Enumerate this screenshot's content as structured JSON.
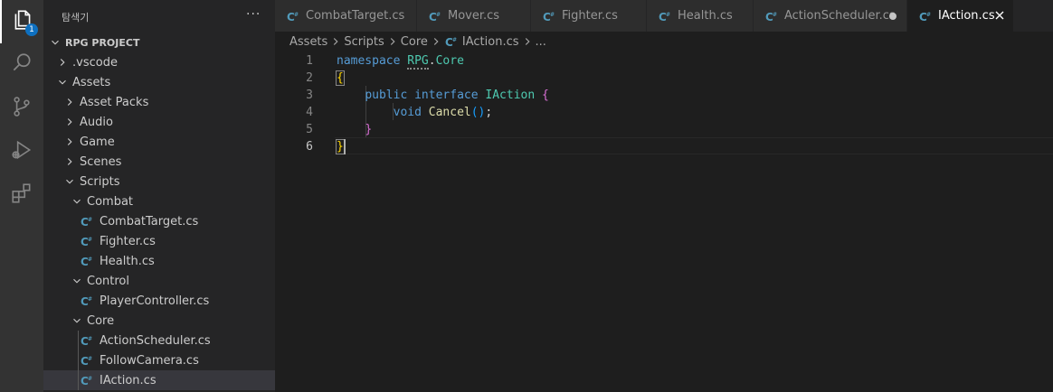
{
  "colors": {
    "activity_bar": "#333333",
    "sidebar": "#252526",
    "editor": "#1e1e1e",
    "badge": "#0e70c0",
    "csharp_icon": "#519aba"
  },
  "activity_bar": {
    "items": [
      {
        "icon": "files-icon",
        "badge": "1"
      },
      {
        "icon": "search-icon"
      },
      {
        "icon": "source-control-icon"
      },
      {
        "icon": "run-debug-icon"
      },
      {
        "icon": "extensions-icon"
      }
    ]
  },
  "sidebar": {
    "title": "탐색기",
    "more": "···",
    "section": "RPG PROJECT",
    "tree": [
      {
        "label": ".vscode",
        "kind": "folder",
        "open": false,
        "depth": 0
      },
      {
        "label": "Assets",
        "kind": "folder",
        "open": true,
        "depth": 0
      },
      {
        "label": "Asset Packs",
        "kind": "folder",
        "open": false,
        "depth": 1
      },
      {
        "label": "Audio",
        "kind": "folder",
        "open": false,
        "depth": 1
      },
      {
        "label": "Game",
        "kind": "folder",
        "open": false,
        "depth": 1
      },
      {
        "label": "Scenes",
        "kind": "folder",
        "open": false,
        "depth": 1
      },
      {
        "label": "Scripts",
        "kind": "folder",
        "open": true,
        "depth": 1
      },
      {
        "label": "Combat",
        "kind": "folder",
        "open": true,
        "depth": 2
      },
      {
        "label": "CombatTarget.cs",
        "kind": "file",
        "depth": 3
      },
      {
        "label": "Fighter.cs",
        "kind": "file",
        "depth": 3
      },
      {
        "label": "Health.cs",
        "kind": "file",
        "depth": 3
      },
      {
        "label": "Control",
        "kind": "folder",
        "open": true,
        "depth": 2
      },
      {
        "label": "PlayerController.cs",
        "kind": "file",
        "depth": 3
      },
      {
        "label": "Core",
        "kind": "folder",
        "open": true,
        "depth": 2
      },
      {
        "label": "ActionScheduler.cs",
        "kind": "file",
        "depth": 3
      },
      {
        "label": "FollowCamera.cs",
        "kind": "file",
        "depth": 3
      },
      {
        "label": "IAction.cs",
        "kind": "file",
        "depth": 3,
        "selected": true
      }
    ]
  },
  "tabs": [
    {
      "label": "CombatTarget.cs",
      "active": false,
      "dirty": false
    },
    {
      "label": "Mover.cs",
      "active": false,
      "dirty": false
    },
    {
      "label": "Fighter.cs",
      "active": false,
      "dirty": false
    },
    {
      "label": "Health.cs",
      "active": false,
      "dirty": false
    },
    {
      "label": "ActionScheduler.cs",
      "active": false,
      "dirty": true
    },
    {
      "label": "IAction.cs",
      "active": true,
      "dirty": false
    }
  ],
  "breadcrumb": {
    "parts": [
      "Assets",
      "Scripts",
      "Core"
    ],
    "file": "IAction.cs",
    "tail": "..."
  },
  "editor": {
    "line_numbers": [
      "1",
      "2",
      "3",
      "4",
      "5",
      "6"
    ],
    "current_line": 6,
    "lines": [
      [
        {
          "t": "namespace",
          "c": "kw"
        },
        {
          "t": " ",
          "c": ""
        },
        {
          "t": "RPG",
          "c": "type dots"
        },
        {
          "t": ".",
          "c": ""
        },
        {
          "t": "Core",
          "c": "type"
        }
      ],
      [
        {
          "t": "{",
          "c": "p1 bm"
        }
      ],
      [
        {
          "t": "    ",
          "c": ""
        },
        {
          "t": "public",
          "c": "kw"
        },
        {
          "t": " ",
          "c": ""
        },
        {
          "t": "interface",
          "c": "kw"
        },
        {
          "t": " ",
          "c": ""
        },
        {
          "t": "IAction",
          "c": "type"
        },
        {
          "t": " ",
          "c": ""
        },
        {
          "t": "{",
          "c": "p2"
        }
      ],
      [
        {
          "t": "        ",
          "c": ""
        },
        {
          "t": "void",
          "c": "kw"
        },
        {
          "t": " ",
          "c": ""
        },
        {
          "t": "Cancel",
          "c": "fn"
        },
        {
          "t": "()",
          "c": "p3"
        },
        {
          "t": ";",
          "c": ""
        }
      ],
      [
        {
          "t": "    ",
          "c": ""
        },
        {
          "t": "}",
          "c": "p2"
        }
      ],
      [
        {
          "t": "}",
          "c": "p1 bm"
        }
      ]
    ]
  }
}
